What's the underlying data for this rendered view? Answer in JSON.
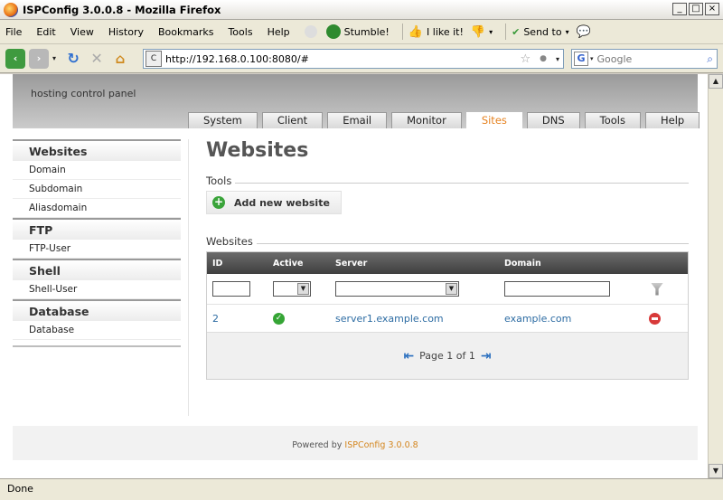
{
  "window": {
    "title": "ISPConfig 3.0.0.8 - Mozilla Firefox"
  },
  "menubar": {
    "items": [
      "File",
      "Edit",
      "View",
      "History",
      "Bookmarks",
      "Tools",
      "Help"
    ],
    "stumble": "Stumble!",
    "ilike": "I like it!",
    "sendto": "Send to"
  },
  "navbar": {
    "url": "http://192.168.0.100:8080/#",
    "search_placeholder": "Google"
  },
  "header": {
    "subtitle": "hosting control panel",
    "logo_fragment": "ISPConfig"
  },
  "tabs": [
    "System",
    "Client",
    "Email",
    "Monitor",
    "Sites",
    "DNS",
    "Tools",
    "Help"
  ],
  "active_tab": "Sites",
  "sidebar": {
    "sections": [
      {
        "title": "Websites",
        "links": [
          "Domain",
          "Subdomain",
          "Aliasdomain"
        ]
      },
      {
        "title": "FTP",
        "links": [
          "FTP-User"
        ]
      },
      {
        "title": "Shell",
        "links": [
          "Shell-User"
        ]
      },
      {
        "title": "Database",
        "links": [
          "Database"
        ]
      }
    ]
  },
  "main": {
    "title": "Websites",
    "tools_label": "Tools",
    "add_button": "Add new website",
    "list_label": "Websites",
    "columns": [
      "ID",
      "Active",
      "Server",
      "Domain"
    ],
    "rows": [
      {
        "id": "2",
        "active": true,
        "server": "server1.example.com",
        "domain": "example.com"
      }
    ],
    "pager": "Page 1 of 1"
  },
  "footer": {
    "prefix": "Powered by",
    "brand": "ISPConfig 3.0.0.8"
  },
  "statusbar": {
    "text": "Done"
  }
}
